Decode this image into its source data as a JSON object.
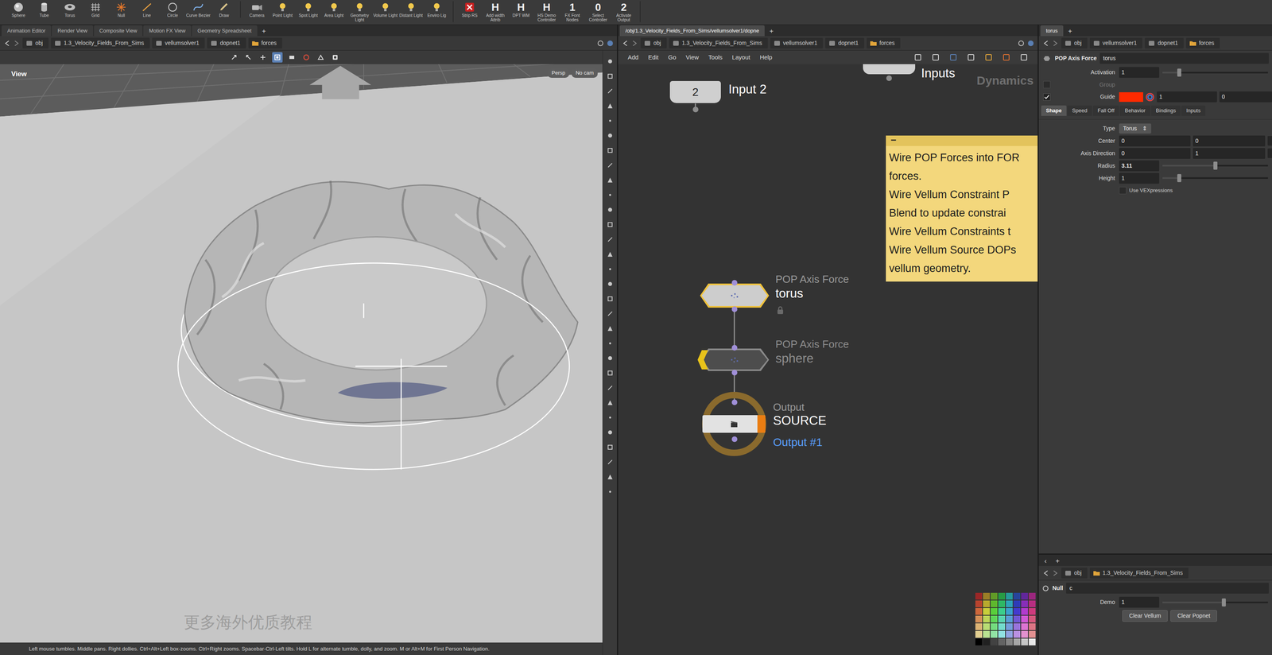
{
  "shelf": {
    "sets": [
      {
        "tools": [
          {
            "label": "Sphere",
            "kind": "sphere"
          },
          {
            "label": "Tube",
            "kind": "tube"
          },
          {
            "label": "Torus",
            "kind": "torus"
          },
          {
            "label": "Grid",
            "kind": "grid"
          },
          {
            "label": "Null",
            "kind": "null"
          },
          {
            "label": "Line",
            "kind": "line"
          },
          {
            "label": "Circle",
            "kind": "circle"
          },
          {
            "label": "Curve Bezier",
            "kind": "curve"
          },
          {
            "label": "Draw",
            "kind": "draw"
          }
        ]
      },
      {
        "tools": [
          {
            "label": "Camera",
            "kind": "camera"
          },
          {
            "label": "Point Light",
            "kind": "light"
          },
          {
            "label": "Spot Light",
            "kind": "light"
          },
          {
            "label": "Area Light",
            "kind": "light"
          },
          {
            "label": "Geometry Light",
            "kind": "light"
          },
          {
            "label": "Volume Light",
            "kind": "light"
          },
          {
            "label": "Distant Light",
            "kind": "light"
          },
          {
            "label": "Enviro Lig",
            "kind": "light"
          }
        ]
      },
      {
        "tools": [
          {
            "label": "Strip RS",
            "kind": "cross"
          },
          {
            "label": "Add width Attrib",
            "kind": "glyph",
            "glyph": "H"
          },
          {
            "label": "DPT WM",
            "kind": "glyph",
            "glyph": "H"
          },
          {
            "label": "HS Demo Controller",
            "kind": "glyph",
            "glyph": "H"
          },
          {
            "label": "FX Font Nodes",
            "kind": "glyph",
            "glyph": "1"
          },
          {
            "label": "Select Controller",
            "kind": "glyph",
            "glyph": "0"
          },
          {
            "label": "Activate Output",
            "kind": "glyph",
            "glyph": "2"
          }
        ]
      }
    ]
  },
  "viewport": {
    "tabs": [
      {
        "label": "Animation Editor",
        "selected": false
      },
      {
        "label": "Render View",
        "selected": false
      },
      {
        "label": "Composite View",
        "selected": false
      },
      {
        "label": "Motion FX View",
        "selected": false
      },
      {
        "label": "Geometry Spreadsheet",
        "selected": false
      }
    ],
    "add_tab": "+",
    "path": [
      "obj",
      "1.3_Velocity_Fields_From_Sims",
      "vellumsolver1",
      "dopnet1",
      "forces"
    ],
    "toolbar": [
      {
        "selected": false
      },
      {
        "selected": false
      },
      {
        "selected": false
      },
      {
        "selected": true
      },
      {
        "selected": false
      },
      {
        "selected": false
      },
      {
        "selected": false
      },
      {
        "selected": false
      }
    ],
    "label": "View",
    "camera_menus": [
      "Persp",
      "No cam"
    ],
    "watermark": "更多海外优质教程",
    "status": "Left mouse tumbles. Middle pans. Right dollies. Ctrl+Alt+Left box-zooms. Ctrl+Right zooms. Spacebar-Ctrl-Left tilts. Hold L for alternate tumble, dolly, and zoom. M or Alt+M for First Person Navigation."
  },
  "network": {
    "tabs": [
      {
        "label": "/obj/1.3_Velocity_Fields_From_Sims/vellumsolver1/dopne",
        "selected": true
      }
    ],
    "add_tab": "+",
    "path": [
      "obj",
      "1.3_Velocity_Fields_From_Sims",
      "vellumsolver1",
      "dopnet1",
      "forces"
    ],
    "menu": [
      "Add",
      "Edit",
      "Go",
      "View",
      "Tools",
      "Layout",
      "Help"
    ],
    "context": "Dynamics",
    "inputs": [
      {
        "badge": "2",
        "label": "Input 2"
      },
      {
        "label": "Inputs"
      }
    ],
    "pop_nodes": [
      {
        "type": "POP Axis Force",
        "name": "torus",
        "selected": true,
        "bypassed": false,
        "locked": true
      },
      {
        "type": "POP Axis Force",
        "name": "sphere",
        "selected": false,
        "bypassed": true,
        "locked": false
      }
    ],
    "output": {
      "type": "Output",
      "name": "SOURCE",
      "sub": "Output #1",
      "display": true
    },
    "note": {
      "collapse": "−",
      "lines": [
        "Wire POP Forces into FOR",
        "forces.",
        "Wire Vellum Constraint P",
        "Blend to update constrai",
        "Wire Vellum Constraints t",
        "Wire Vellum Source DOPs",
        "vellum geometry."
      ]
    }
  },
  "params": {
    "tabs": [
      {
        "label": "torus",
        "selected": true
      }
    ],
    "add_tab": "+",
    "path": [
      "obj",
      "vellumsolver1",
      "dopnet1",
      "forces"
    ],
    "node_type": "POP Axis Force",
    "node_name": "torus",
    "activation": {
      "label": "Activation",
      "value": "1",
      "level": 0.16
    },
    "group": {
      "label": "Group",
      "disabled": true,
      "checked": false
    },
    "guide": {
      "label": "Guide",
      "checked": true,
      "color": "#ff2a00",
      "values": [
        "1",
        "0"
      ]
    },
    "folders": [
      {
        "label": "Shape",
        "selected": true
      },
      {
        "label": "Speed",
        "selected": false
      },
      {
        "label": "Fall Off",
        "selected": false
      },
      {
        "label": "Behavior",
        "selected": false
      },
      {
        "label": "Bindings",
        "selected": false
      },
      {
        "label": "Inputs",
        "selected": false
      }
    ],
    "type": {
      "label": "Type",
      "value": "Torus",
      "arrow": "⇕"
    },
    "vectors": [
      {
        "label": "Center",
        "values": [
          "0",
          "0"
        ]
      },
      {
        "label": "Axis Direction",
        "values": [
          "0",
          "1"
        ]
      }
    ],
    "sliders": [
      {
        "label": "Radius",
        "value": "3.11",
        "level": 0.5
      },
      {
        "label": "Height",
        "value": "1",
        "level": 0.16
      }
    ],
    "toggle": {
      "label": "Use VEXpressions",
      "checked": false
    }
  },
  "lower": {
    "nav": "‹",
    "add_tab": "+",
    "path": [
      "obj",
      "1.3_Velocity_Fields_From_Sims"
    ],
    "node_type": "Null",
    "node_name": "c",
    "demo": {
      "label": "Demo",
      "value": "1",
      "level": 0.58
    },
    "buttons": [
      "Clear Vellum",
      "Clear Popnet"
    ]
  }
}
